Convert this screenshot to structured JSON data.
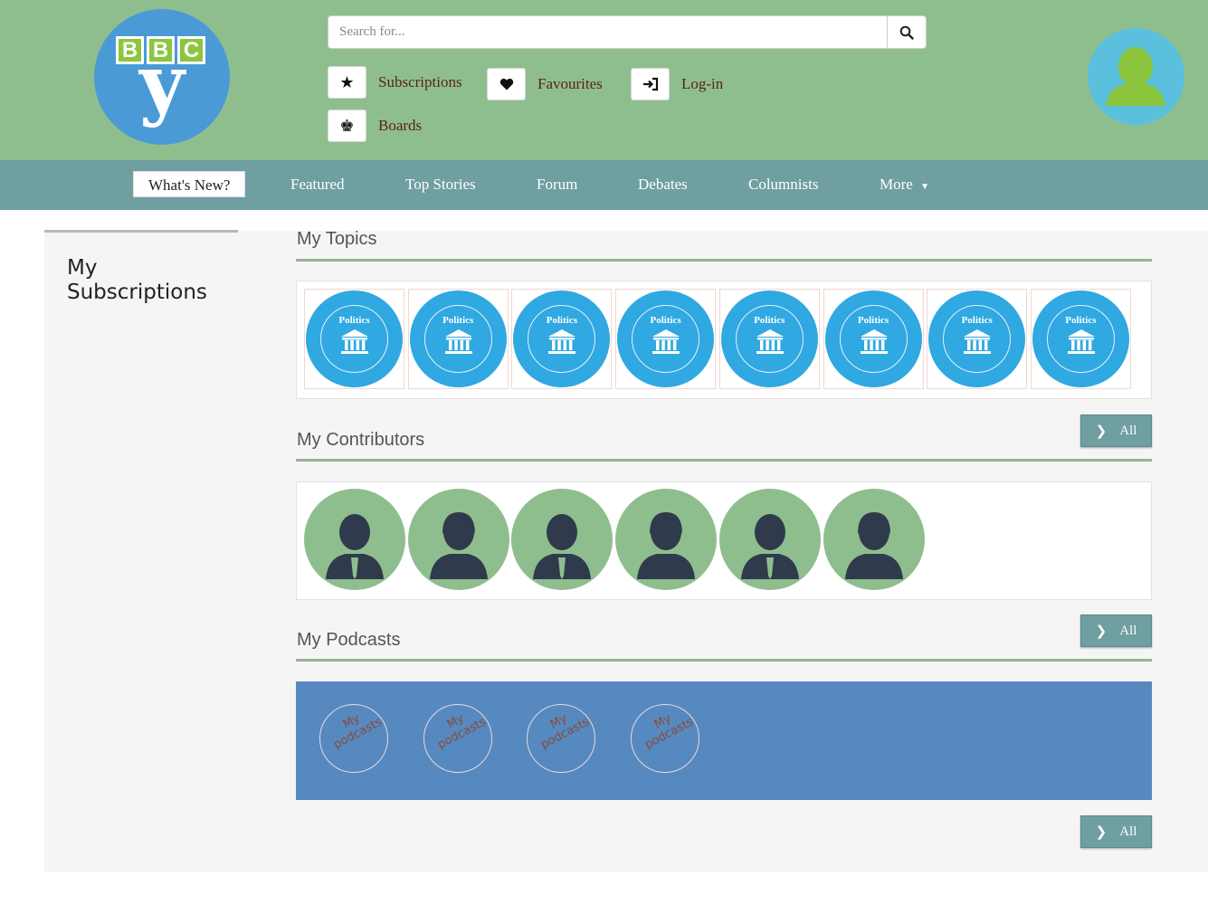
{
  "header": {
    "logo_letters": [
      "B",
      "B",
      "C"
    ],
    "logo_y": "y",
    "search": {
      "placeholder": "Search for..."
    },
    "quick_links": {
      "subscriptions": "Subscriptions",
      "favourites": "Favourites",
      "login": "Log-in",
      "boards": "Boards"
    }
  },
  "nav": {
    "items": [
      {
        "label": "What's New?",
        "active": true
      },
      {
        "label": "Featured"
      },
      {
        "label": "Top Stories"
      },
      {
        "label": "Forum"
      },
      {
        "label": "Debates"
      },
      {
        "label": "Columnists"
      },
      {
        "label": "More"
      }
    ]
  },
  "sidebar": {
    "title_line1": "My",
    "title_line2": "Subscriptions"
  },
  "sections": {
    "topics": {
      "title": "My Topics",
      "items": [
        "Politics",
        "Politics",
        "Politics",
        "Politics",
        "Politics",
        "Politics",
        "Politics",
        "Politics"
      ]
    },
    "contributors": {
      "title": "My Contributors",
      "avatars": [
        "male",
        "female",
        "male",
        "female",
        "male",
        "female"
      ],
      "all_label": "All"
    },
    "podcasts": {
      "title": "My Podcasts",
      "items": [
        {
          "line1": "My",
          "line2": "podcasts"
        },
        {
          "line1": "My",
          "line2": "podcasts"
        },
        {
          "line1": "My",
          "line2": "podcasts"
        },
        {
          "line1": "My",
          "line2": "podcasts"
        }
      ],
      "all_label": "All"
    },
    "bottom_all_label": "All"
  },
  "colors": {
    "header_bg": "#8fbe8e",
    "nav_bg": "#6f9fa1",
    "topic_blue": "#30a8e1",
    "podcast_panel": "#5689bf",
    "avatar_bg": "#5bc0de",
    "user_icon": "#8cc63f"
  },
  "icons": {
    "search": "search-icon",
    "subscriptions": "star-icon",
    "favourites": "heart-icon",
    "login": "sign-in-icon",
    "boards": "chess-king-icon",
    "nav_more": "caret-down-icon",
    "all_buttons": "chevron-right-icon"
  }
}
